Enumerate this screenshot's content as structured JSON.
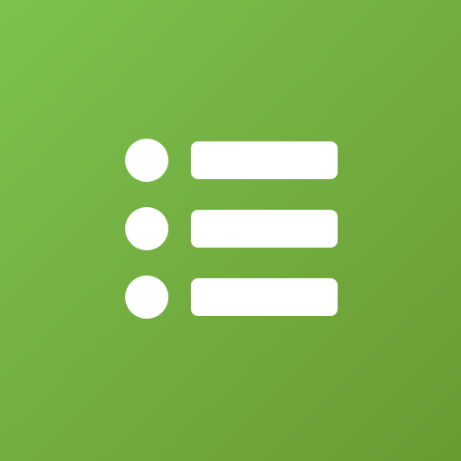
{
  "icon": {
    "name": "list-icon",
    "background_colors": [
      "#7bc24e",
      "#6a9a32"
    ],
    "glyph_color": "#ffffff",
    "rows": [
      {
        "name": "list-row-1"
      },
      {
        "name": "list-row-2"
      },
      {
        "name": "list-row-3"
      }
    ]
  }
}
